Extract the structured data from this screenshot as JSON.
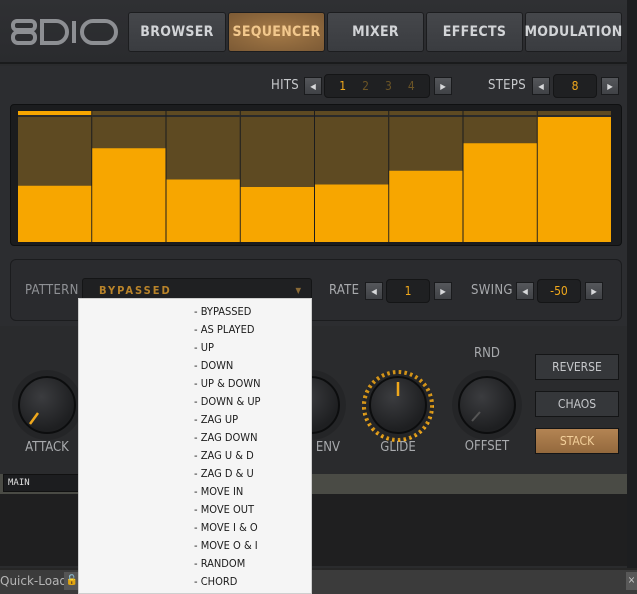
{
  "brand": {
    "logo_text": "8DIO"
  },
  "tabs": [
    {
      "label": "BROWSER",
      "active": false
    },
    {
      "label": "SEQUENCER",
      "active": true
    },
    {
      "label": "MIXER",
      "active": false
    },
    {
      "label": "EFFECTS",
      "active": false
    },
    {
      "label": "MODULATION",
      "active": false
    }
  ],
  "sequencer": {
    "hits_label": "HITS",
    "hits_values": [
      "1",
      "2",
      "3",
      "4"
    ],
    "hits_selected": "1",
    "steps_label": "STEPS",
    "steps_value": "8",
    "step_levels": [
      0.45,
      0.75,
      0.5,
      0.44,
      0.46,
      0.57,
      0.79,
      1.0
    ],
    "current_step": 1,
    "colors": {
      "bar": "#f7a600",
      "bar_bg": "#5e4a22",
      "accent": "#f0a81c"
    }
  },
  "pattern": {
    "label": "PATTERN",
    "value": "BYPASSED",
    "rate_label": "RATE",
    "rate_value": "1",
    "swing_label": "SWING",
    "swing_value": "-50",
    "options": [
      "- BYPASSED",
      "- AS PLAYED",
      "- UP",
      "- DOWN",
      "- UP & DOWN",
      "- DOWN & UP",
      "- ZAG UP",
      "- ZAG DOWN",
      "- ZAG U & D",
      "- ZAG D & U",
      "- MOVE IN",
      "- MOVE OUT",
      "- MOVE I & O",
      "- MOVE O & I",
      "- RANDOM",
      "- CHORD"
    ]
  },
  "knobs": {
    "attack": "ATTACK",
    "env": "ENV",
    "glide": "GLIDE",
    "rnd": "RND",
    "offset": "OFFSET"
  },
  "side_buttons": [
    {
      "label": "REVERSE",
      "active": false
    },
    {
      "label": "CHAOS",
      "active": false
    },
    {
      "label": "STACK",
      "active": true
    }
  ],
  "main_tag": "MAIN",
  "footer": {
    "quickload": "Quick-Load",
    "lock_icon": "🔓",
    "close_icon": "×"
  }
}
